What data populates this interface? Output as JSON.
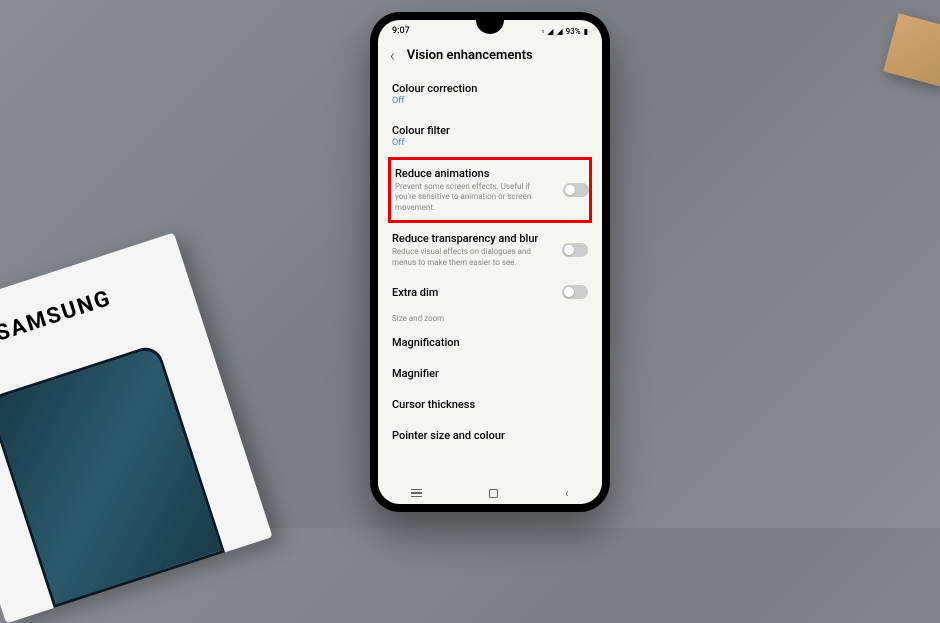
{
  "status_bar": {
    "time": "9:07",
    "battery": "93%"
  },
  "samsung_box_logo": "SAMSUNG",
  "header": {
    "title": "Vision enhancements"
  },
  "settings": {
    "colour_correction": {
      "title": "Colour correction",
      "value": "Off"
    },
    "colour_filter": {
      "title": "Colour filter",
      "value": "Off"
    },
    "reduce_animations": {
      "title": "Reduce animations",
      "desc": "Prevent some screen effects. Useful if you're sensitive to animation or screen movement."
    },
    "reduce_transparency": {
      "title": "Reduce transparency and blur",
      "desc": "Reduce visual effects on dialogues and menus to make them easier to see."
    },
    "extra_dim": {
      "title": "Extra dim"
    },
    "section_label": "Size and zoom",
    "magnification": {
      "title": "Magnification"
    },
    "magnifier": {
      "title": "Magnifier"
    },
    "cursor_thickness": {
      "title": "Cursor thickness"
    },
    "pointer_size": {
      "title": "Pointer size and colour"
    }
  }
}
